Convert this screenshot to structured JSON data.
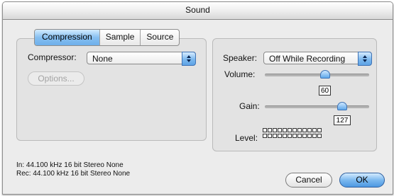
{
  "window": {
    "title": "Sound"
  },
  "tabs": [
    {
      "label": "Compression",
      "active": true
    },
    {
      "label": "Sample",
      "active": false
    },
    {
      "label": "Source",
      "active": false
    }
  ],
  "compression": {
    "compressor_label": "Compressor:",
    "compressor_value": "None",
    "options_label": "Options..."
  },
  "output": {
    "speaker_label": "Speaker:",
    "speaker_value": "Off While Recording",
    "volume_label": "Volume:",
    "volume_value": "60",
    "gain_label": "Gain:",
    "gain_value": "127",
    "level_label": "Level:"
  },
  "info": {
    "in_line": "In: 44.100 kHz 16 bit Stereo None",
    "rec_line": "Rec: 44.100 kHz 16 bit Stereo None"
  },
  "buttons": {
    "cancel": "Cancel",
    "ok": "OK"
  },
  "colors": {
    "accent": "#6fb0eb",
    "window_bg": "#ececec",
    "panel_bg": "#e3e3e3"
  }
}
